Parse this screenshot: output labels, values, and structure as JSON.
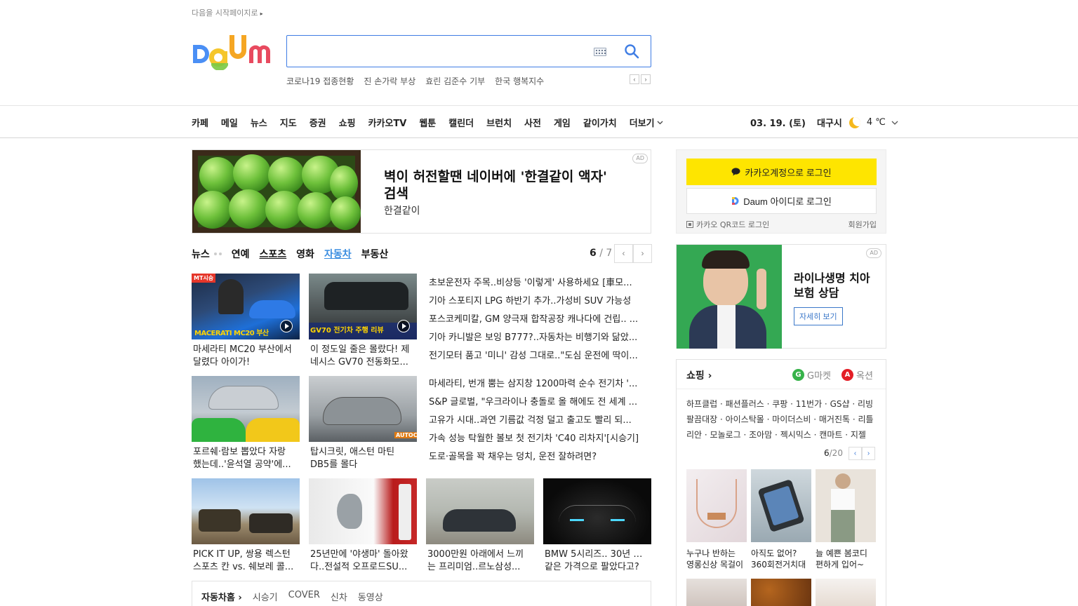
{
  "top": {
    "start_page_label": "다음을 시작페이지로"
  },
  "search": {
    "placeholder": "",
    "value": ""
  },
  "trends": [
    "코로나19 접종현황",
    "진 손가락 부상",
    "효린 김준수 기부",
    "한국 행복지수"
  ],
  "nav": {
    "items": [
      "카페",
      "메일",
      "뉴스",
      "지도",
      "증권",
      "쇼핑",
      "카카오TV",
      "웹툰",
      "캘린더",
      "브런치",
      "사전",
      "게임",
      "같이가치"
    ],
    "more": "더보기",
    "date": "03. 19. (토)",
    "city": "대구시",
    "temp": "4 ℃"
  },
  "ad_banner": {
    "tag": "AD",
    "title": "벽이 허전할땐 네이버에 '한결같이 액자' 검색",
    "subtitle": "한결같이"
  },
  "news": {
    "tabs": [
      "뉴스",
      "연예",
      "스포츠",
      "영화",
      "자동차",
      "부동산"
    ],
    "active_tab": "자동차",
    "page": "6",
    "total": "7",
    "cards": [
      {
        "line1": "마세라티 MC20 부산에서",
        "line2": "달렸다 아이가!",
        "thumb_text": "MACERATI MC20 부산"
      },
      {
        "line1": "이 정도일 줄은 몰랐다! 제",
        "line2": "네시스 GV70 전동화모...",
        "thumb_text": "GV70 전기차 주행 리뷰"
      },
      {
        "line1": "포르쉐·람보 뽑았다 자랑",
        "line2": "했는데..'윤석열 공약'에..."
      },
      {
        "line1": "탑시크릿, 애스턴 마틴",
        "line2": "DB5를 몰다"
      },
      {
        "line1": "PICK IT UP, 쌍용 렉스턴",
        "line2": "스포츠 칸 vs. 쉐보레 콜..."
      },
      {
        "line1": "25년만에 '야생마' 돌아왔",
        "line2": "다..전설적 오프로드SU..."
      },
      {
        "line1": "3000만원 아래에서 느끼",
        "line2": "는 프리미엄..르노삼성..."
      },
      {
        "line1": "BMW 5시리즈.. 30년 동안",
        "line2": "같은 가격으로 팔았다고?"
      }
    ],
    "headlines_a": [
      "초보운전자 주목..비상등 '이렇게' 사용하세요 [車모...",
      "기아 스포티지 LPG 하반기 추가..가성비 SUV 가능성",
      "포스코케미칼, GM 양극재 합작공장 캐나다에 건립.. ...",
      "기아 카니발은 보잉 B777?..자동차는 비행기와 닮았...",
      "전기모터 품고 '미니' 감성 그대로..\"도심 운전에 딱이..."
    ],
    "headlines_b": [
      "마세라티, 번개 뿜는 삼지창 1200마력 순수 전기차 '...",
      "S&P 글로벌, \"우크라이나 충돌로 올 해에도 전 세계 ...",
      "고유가 시대..과연 기름값 걱정 덜고 출고도 빨리 되...",
      "가속 성능 탁월한 볼보 첫 전기차 'C40 리차지'[시승기]",
      "도로·골목을 꽉 채우는 덩치, 운전 잘하려면?"
    ],
    "bottom": {
      "title": "자동차홈",
      "items": [
        "시승기",
        "COVER",
        "신차",
        "동영상"
      ]
    }
  },
  "login": {
    "kakao_label": "카카오계정으로 로그인",
    "daum_label": "Daum 아이디로 로그인",
    "qr_label": "카카오 QR코드 로그인",
    "join_label": "회원가입"
  },
  "ad_side": {
    "tag": "AD",
    "title": "라이나생명 치아보험 상담",
    "button": "자세히 보기"
  },
  "shop": {
    "title": "쇼핑",
    "gmarket": "G마켓",
    "auction": "옥션",
    "links_text": "하프클럽 · 패션플러스 · 쿠팡 · 11번가 · GS샵 · 리빙팔끔대장 · 아이스탁몰 · 마이더스비 · 매거진톡 · 리틀리안 · 모놀로그 · 조아맘 · 젝시믹스 · 캔마트 · 지젤",
    "page": "6",
    "total": "/20",
    "items": [
      {
        "line1": "누구나 반하는",
        "line2": "영롱신상 목걸이"
      },
      {
        "line1": "아직도 없어?",
        "line2": "360회전거치대"
      },
      {
        "line1": "늘 예쁜 봄코디",
        "line2": "편하게 입어~"
      }
    ]
  },
  "colors": {
    "accent": "#3f7de4",
    "kakao_yellow": "#fee500",
    "active_tab": "#3a8de0"
  }
}
